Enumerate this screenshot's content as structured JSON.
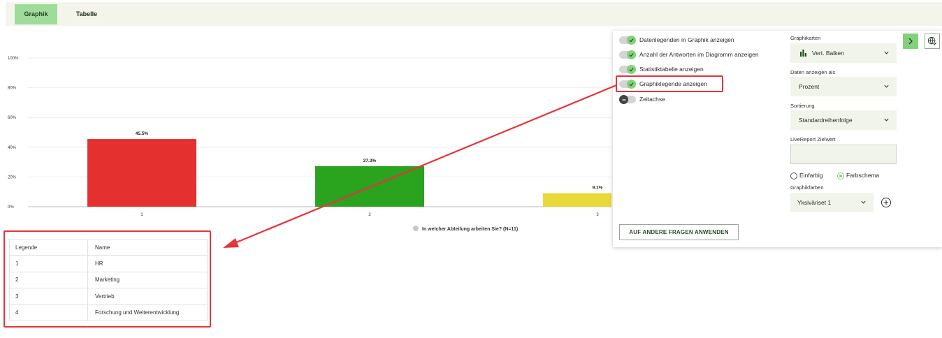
{
  "tabs": [
    {
      "label": "Graphik",
      "active": true
    },
    {
      "label": "Tabelle",
      "active": false
    }
  ],
  "chart_data": {
    "type": "bar",
    "categories": [
      "1",
      "2",
      "3"
    ],
    "values": [
      45.5,
      27.3,
      9.1
    ],
    "data_labels": [
      "45.5%",
      "27.3%",
      "9.1%"
    ],
    "bar_colors": [
      "#e53030",
      "#2aa31f",
      "#e8d93a"
    ],
    "ylim": [
      0,
      100
    ],
    "yticks": [
      "0%",
      "20%",
      "40%",
      "60%",
      "80%",
      "100%"
    ],
    "grid": true,
    "legend": {
      "label": "In welcher Abteilung arbeiten Sie? (N=11)",
      "placement": "bottom",
      "marker_color": "#c8c8c8"
    }
  },
  "legend_table": {
    "headers": [
      "Legende",
      "Name"
    ],
    "rows": [
      [
        "1",
        "HR"
      ],
      [
        "2",
        "Marketing"
      ],
      [
        "3",
        "Vertrieb"
      ],
      [
        "4",
        "Forschung und Weiterentwicklung"
      ]
    ]
  },
  "settings": {
    "toggles": [
      {
        "label": "Datenlegenden in Graphik anzeigen",
        "on": true
      },
      {
        "label": "Anzahl der Antworten im Diagramm anzeigen",
        "on": true
      },
      {
        "label": "Statistiktabelle anzeigen",
        "on": true
      },
      {
        "label": "Graphiklegende anzeigen",
        "on": true
      },
      {
        "label": "Zeitachse",
        "on": false
      }
    ],
    "chart_type_label": "Graphikarten",
    "chart_type_value": "Vert. Balken",
    "show_as_label": "Daten anzeigen als",
    "show_as_value": "Prozent",
    "sort_label": "Sortierung",
    "sort_value": "Standardreihenfolge",
    "livereport_label": "LiveReport Zielwert",
    "livereport_value": "",
    "color_mode_options": [
      "Einfarbig",
      "Farbschema"
    ],
    "color_mode_selected": "Farbschema",
    "colors_label": "Graphikfarben",
    "colors_value": "Yksiväriset 1",
    "apply_button": "AUF ANDERE FRAGEN ANWENDEN"
  },
  "annotation": {
    "color": "#e8333b"
  },
  "accent_color": "#82d27c"
}
